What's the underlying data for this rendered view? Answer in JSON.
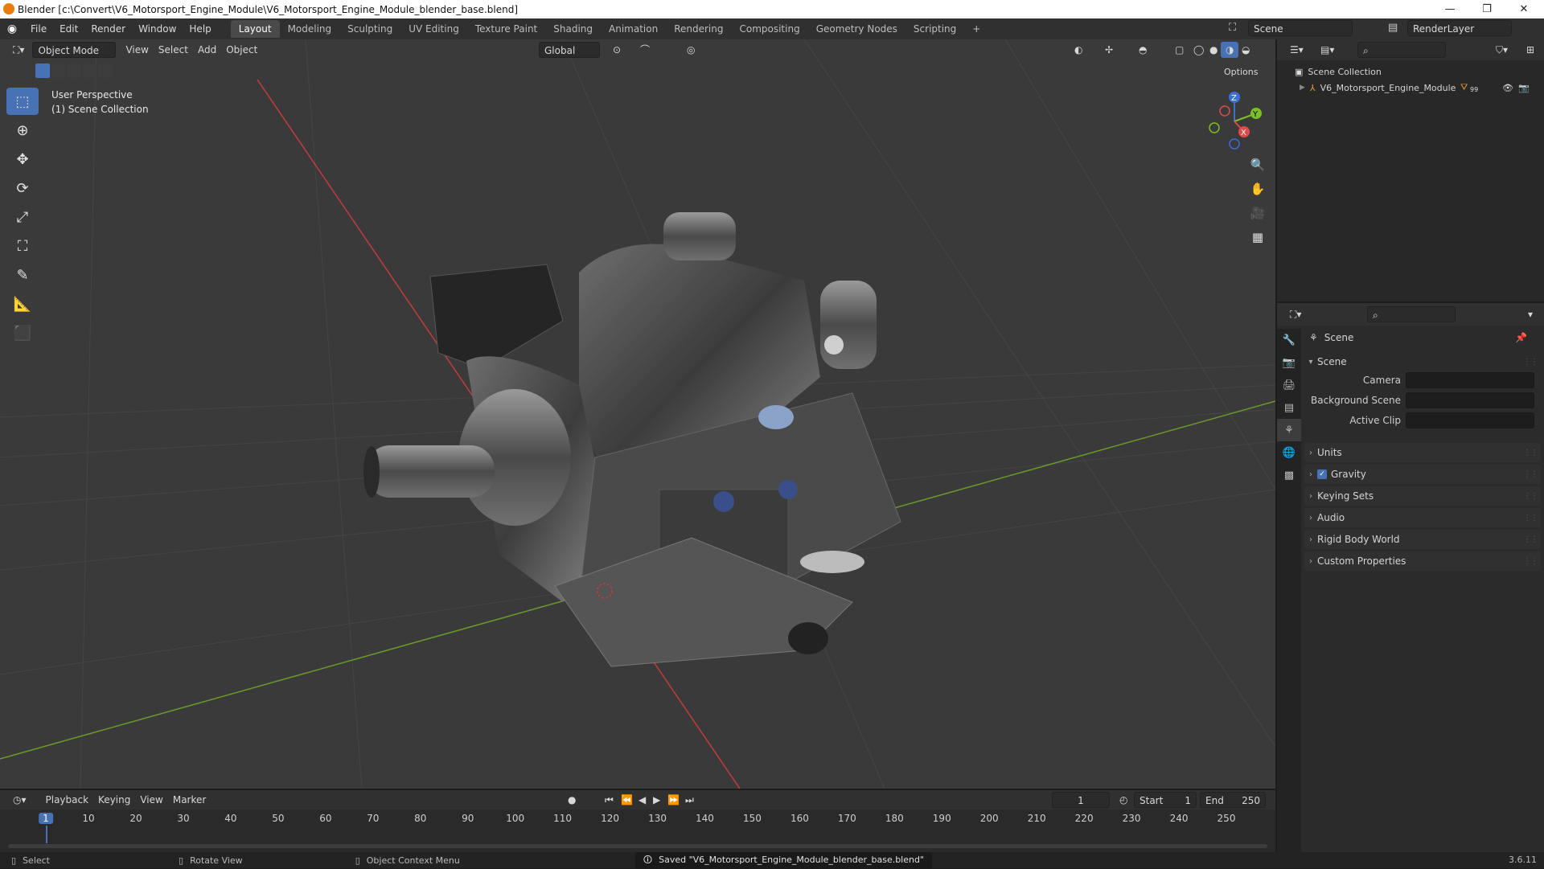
{
  "window": {
    "title": "Blender [c:\\Convert\\V6_Motorsport_Engine_Module\\V6_Motorsport_Engine_Module_blender_base.blend]",
    "minimize": "—",
    "maximize": "❐",
    "close": "✕"
  },
  "menubar": {
    "menus": [
      "File",
      "Edit",
      "Render",
      "Window",
      "Help"
    ],
    "workspaces": [
      "Layout",
      "Modeling",
      "Sculpting",
      "UV Editing",
      "Texture Paint",
      "Shading",
      "Animation",
      "Rendering",
      "Compositing",
      "Geometry Nodes",
      "Scripting"
    ],
    "active_workspace": "Layout",
    "add_tab": "+",
    "scene_name": "Scene",
    "view_layer": "RenderLayer"
  },
  "viewport": {
    "mode": "Object Mode",
    "menus": [
      "View",
      "Select",
      "Add",
      "Object"
    ],
    "orientation": "Global",
    "options": "Options",
    "overlay_line1": "User Perspective",
    "overlay_line2": "(1) Scene Collection",
    "axis_labels": {
      "z": "Z",
      "y": "Y",
      "x": "X"
    },
    "tools": [
      "select-box-icon",
      "cursor-icon",
      "move-icon",
      "rotate-icon",
      "scale-icon",
      "transform-icon",
      "annotate-icon",
      "measure-icon",
      "add-cube-icon"
    ]
  },
  "outliner": {
    "root": "Scene Collection",
    "object": "V6_Motorsport_Engine_Module",
    "badge": "99"
  },
  "properties": {
    "header": "Scene",
    "section_title": "Scene",
    "fields": [
      {
        "label": "Camera",
        "value": ""
      },
      {
        "label": "Background Scene",
        "value": ""
      },
      {
        "label": "Active Clip",
        "value": ""
      }
    ],
    "panels": [
      "Units",
      "Gravity",
      "Keying Sets",
      "Audio",
      "Rigid Body World",
      "Custom Properties"
    ],
    "gravity_checked": true
  },
  "timeline": {
    "menus": [
      "Playback",
      "Keying",
      "View",
      "Marker"
    ],
    "current_frame": "1",
    "start_label": "Start",
    "start": "1",
    "end_label": "End",
    "end": "250",
    "ticks": [
      "1",
      "10",
      "20",
      "30",
      "40",
      "50",
      "60",
      "70",
      "80",
      "90",
      "100",
      "110",
      "120",
      "130",
      "140",
      "150",
      "160",
      "170",
      "180",
      "190",
      "200",
      "210",
      "220",
      "230",
      "240",
      "250"
    ]
  },
  "statusbar": {
    "select": "Select",
    "rotate": "Rotate View",
    "context": "Object Context Menu",
    "message": "Saved \"V6_Motorsport_Engine_Module_blender_base.blend\"",
    "version": "3.6.11"
  },
  "colors": {
    "accent": "#4772b3",
    "x_axis": "#c43c3c",
    "y_axis": "#6a9a2a",
    "viewport_bg": "#3a3a3a"
  }
}
